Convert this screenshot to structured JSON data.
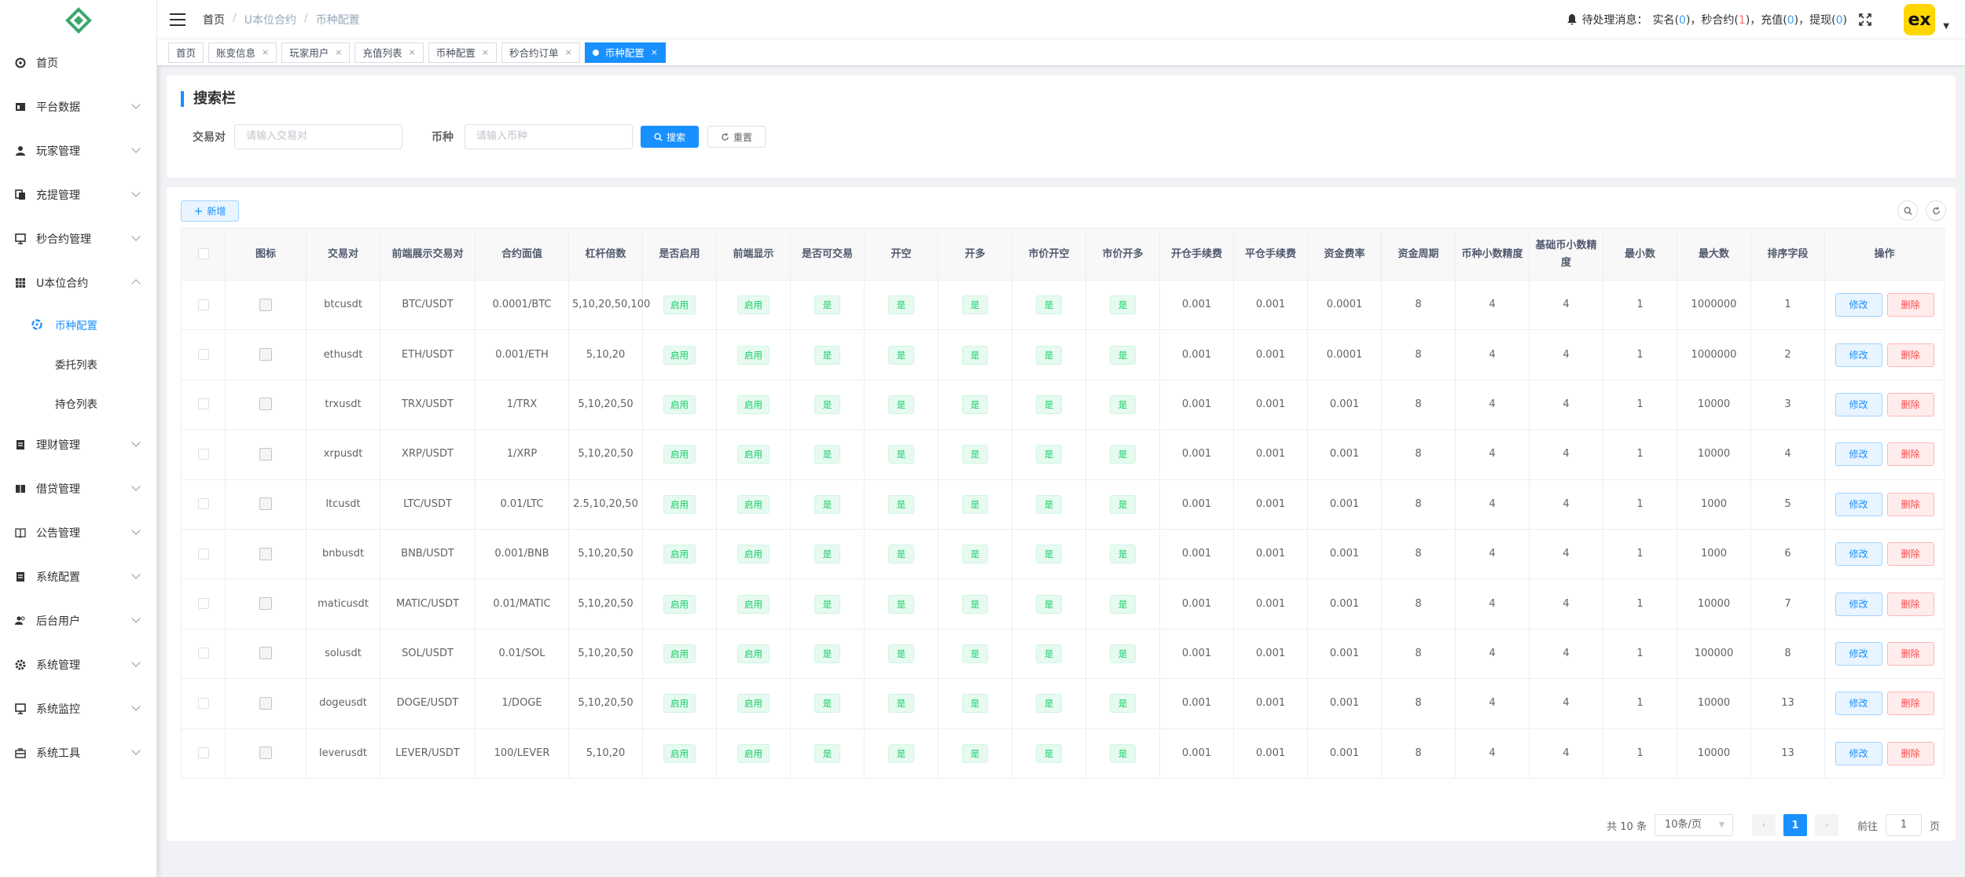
{
  "sidebar": {
    "menu": [
      {
        "label": "首页",
        "icon": "dashboard-icon"
      },
      {
        "label": "平台数据",
        "icon": "chart-icon"
      },
      {
        "label": "玩家管理",
        "icon": "user-icon"
      },
      {
        "label": "充提管理",
        "icon": "wallet-icon"
      },
      {
        "label": "秒合约管理",
        "icon": "monitor-icon"
      },
      {
        "label": "U本位合约",
        "icon": "table-icon"
      },
      {
        "label": "理财管理",
        "icon": "doc-icon"
      },
      {
        "label": "借贷管理",
        "icon": "book-icon"
      },
      {
        "label": "公告管理",
        "icon": "notice-icon"
      },
      {
        "label": "系统配置",
        "icon": "doc-icon"
      },
      {
        "label": "后台用户",
        "icon": "users-icon"
      },
      {
        "label": "系统管理",
        "icon": "gear-icon"
      },
      {
        "label": "系统监控",
        "icon": "monitor-icon"
      },
      {
        "label": "系统工具",
        "icon": "tool-icon"
      }
    ],
    "submenu": [
      "币种配置",
      "委托列表",
      "持仓列表"
    ]
  },
  "header": {
    "breadcrumb": [
      "首页",
      "U本位合约",
      "币种配置"
    ],
    "notice_label": "待处理消息：",
    "notice_items": [
      {
        "label": "实名",
        "count": "0"
      },
      {
        "label": "秒合约",
        "count": "1"
      },
      {
        "label": "充值",
        "count": "0"
      },
      {
        "label": "提现",
        "count": "0"
      }
    ],
    "avatar_text": "ex"
  },
  "tags": [
    {
      "label": "首页",
      "closable": false
    },
    {
      "label": "账变信息",
      "closable": true
    },
    {
      "label": "玩家用户",
      "closable": true
    },
    {
      "label": "充值列表",
      "closable": true
    },
    {
      "label": "币种配置",
      "closable": true
    },
    {
      "label": "秒合约订单",
      "closable": true
    },
    {
      "label": "币种配置",
      "closable": true,
      "active": true
    }
  ],
  "search": {
    "title": "搜索栏",
    "pair_label": "交易对",
    "pair_placeholder": "请输入交易对",
    "coin_label": "币种",
    "coin_placeholder": "请输入币种",
    "search_btn": "搜索",
    "reset_btn": "重置"
  },
  "toolbar": {
    "add_btn": "新增"
  },
  "table": {
    "headers": [
      "图标",
      "交易对",
      "前端展示交易对",
      "合约面值",
      "杠杆倍数",
      "是否启用",
      "前端显示",
      "是否可交易",
      "开空",
      "开多",
      "市价开空",
      "市价开多",
      "开仓手续费",
      "平仓手续费",
      "资金费率",
      "资金周期",
      "币种小数精度",
      "基础币小数精度",
      "最小数",
      "最大数",
      "排序字段",
      "操作"
    ],
    "enable_text": "启用",
    "yes_text": "是",
    "edit_text": "修改",
    "delete_text": "删除",
    "rows": [
      {
        "pair": "btcusdt",
        "display": "BTC/USDT",
        "face": "0.0001/BTC",
        "lever": "5,10,20,50,100",
        "open_fee": "0.001",
        "close_fee": "0.001",
        "rate": "0.0001",
        "period": "8",
        "coin_prec": "4",
        "base_prec": "4",
        "min": "1",
        "max": "1000000",
        "sort": "1"
      },
      {
        "pair": "ethusdt",
        "display": "ETH/USDT",
        "face": "0.001/ETH",
        "lever": "5,10,20",
        "open_fee": "0.001",
        "close_fee": "0.001",
        "rate": "0.0001",
        "period": "8",
        "coin_prec": "4",
        "base_prec": "4",
        "min": "1",
        "max": "1000000",
        "sort": "2"
      },
      {
        "pair": "trxusdt",
        "display": "TRX/USDT",
        "face": "1/TRX",
        "lever": "5,10,20,50",
        "open_fee": "0.001",
        "close_fee": "0.001",
        "rate": "0.001",
        "period": "8",
        "coin_prec": "4",
        "base_prec": "4",
        "min": "1",
        "max": "10000",
        "sort": "3"
      },
      {
        "pair": "xrpusdt",
        "display": "XRP/USDT",
        "face": "1/XRP",
        "lever": "5,10,20,50",
        "open_fee": "0.001",
        "close_fee": "0.001",
        "rate": "0.001",
        "period": "8",
        "coin_prec": "4",
        "base_prec": "4",
        "min": "1",
        "max": "10000",
        "sort": "4"
      },
      {
        "pair": "ltcusdt",
        "display": "LTC/USDT",
        "face": "0.01/LTC",
        "lever": "2.5,10,20,50",
        "open_fee": "0.001",
        "close_fee": "0.001",
        "rate": "0.001",
        "period": "8",
        "coin_prec": "4",
        "base_prec": "4",
        "min": "1",
        "max": "1000",
        "sort": "5"
      },
      {
        "pair": "bnbusdt",
        "display": "BNB/USDT",
        "face": "0.001/BNB",
        "lever": "5,10,20,50",
        "open_fee": "0.001",
        "close_fee": "0.001",
        "rate": "0.001",
        "period": "8",
        "coin_prec": "4",
        "base_prec": "4",
        "min": "1",
        "max": "1000",
        "sort": "6"
      },
      {
        "pair": "maticusdt",
        "display": "MATIC/USDT",
        "face": "0.01/MATIC",
        "lever": "5,10,20,50",
        "open_fee": "0.001",
        "close_fee": "0.001",
        "rate": "0.001",
        "period": "8",
        "coin_prec": "4",
        "base_prec": "4",
        "min": "1",
        "max": "10000",
        "sort": "7"
      },
      {
        "pair": "solusdt",
        "display": "SOL/USDT",
        "face": "0.01/SOL",
        "lever": "5,10,20,50",
        "open_fee": "0.001",
        "close_fee": "0.001",
        "rate": "0.001",
        "period": "8",
        "coin_prec": "4",
        "base_prec": "4",
        "min": "1",
        "max": "100000",
        "sort": "8"
      },
      {
        "pair": "dogeusdt",
        "display": "DOGE/USDT",
        "face": "1/DOGE",
        "lever": "5,10,20,50",
        "open_fee": "0.001",
        "close_fee": "0.001",
        "rate": "0.001",
        "period": "8",
        "coin_prec": "4",
        "base_prec": "4",
        "min": "1",
        "max": "10000",
        "sort": "13"
      },
      {
        "pair": "leverusdt",
        "display": "LEVER/USDT",
        "face": "100/LEVER",
        "lever": "5,10,20",
        "open_fee": "0.001",
        "close_fee": "0.001",
        "rate": "0.001",
        "period": "8",
        "coin_prec": "4",
        "base_prec": "4",
        "min": "1",
        "max": "10000",
        "sort": "13"
      }
    ]
  },
  "pagination": {
    "total_text": "共 10 条",
    "page_size": "10条/页",
    "current_page": "1",
    "goto_label": "前往",
    "goto_value": "1",
    "page_unit": "页"
  },
  "colors": {
    "primary": "#1890ff",
    "success": "#13ce66",
    "danger": "#ff4949",
    "avatar_bg": "#ffd600"
  }
}
